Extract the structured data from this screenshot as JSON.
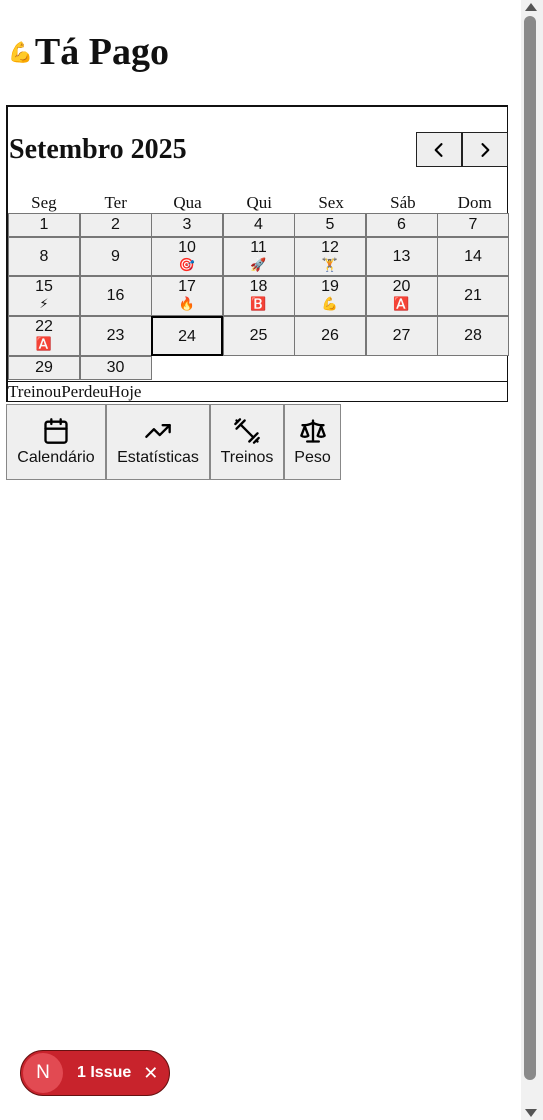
{
  "app": {
    "title": "Tá Pago",
    "title_emoji": "💪"
  },
  "calendar": {
    "month_label": "Setembro 2025",
    "weekdays": [
      "Seg",
      "Ter",
      "Qua",
      "Qui",
      "Sex",
      "Sáb",
      "Dom"
    ],
    "days": [
      {
        "n": "1",
        "e": ""
      },
      {
        "n": "2",
        "e": ""
      },
      {
        "n": "3",
        "e": ""
      },
      {
        "n": "4",
        "e": ""
      },
      {
        "n": "5",
        "e": ""
      },
      {
        "n": "6",
        "e": ""
      },
      {
        "n": "7",
        "e": ""
      },
      {
        "n": "8",
        "e": ""
      },
      {
        "n": "9",
        "e": ""
      },
      {
        "n": "10",
        "e": "🎯"
      },
      {
        "n": "11",
        "e": "🚀"
      },
      {
        "n": "12",
        "e": "🏋️"
      },
      {
        "n": "13",
        "e": ""
      },
      {
        "n": "14",
        "e": ""
      },
      {
        "n": "15",
        "e": "⚡"
      },
      {
        "n": "16",
        "e": ""
      },
      {
        "n": "17",
        "e": "🔥"
      },
      {
        "n": "18",
        "e": "🅱️"
      },
      {
        "n": "19",
        "e": "💪"
      },
      {
        "n": "20",
        "e": "🅰️"
      },
      {
        "n": "21",
        "e": ""
      },
      {
        "n": "22",
        "e": "🅰️"
      },
      {
        "n": "23",
        "e": ""
      },
      {
        "n": "24",
        "e": "",
        "today": true
      },
      {
        "n": "25",
        "e": ""
      },
      {
        "n": "26",
        "e": ""
      },
      {
        "n": "27",
        "e": ""
      },
      {
        "n": "28",
        "e": ""
      },
      {
        "n": "29",
        "e": ""
      },
      {
        "n": "30",
        "e": ""
      }
    ],
    "legend": "TreinouPerdeuHoje"
  },
  "tabs": [
    {
      "label": "Calendário",
      "icon": "calendar-icon"
    },
    {
      "label": "Estatísticas",
      "icon": "trending-up-icon"
    },
    {
      "label": "Treinos",
      "icon": "dumbbell-icon"
    },
    {
      "label": "Peso",
      "icon": "scale-icon"
    }
  ],
  "issue_badge": {
    "letter": "N",
    "label": "1 Issue",
    "close": "✕",
    "color": "#c8232c"
  }
}
